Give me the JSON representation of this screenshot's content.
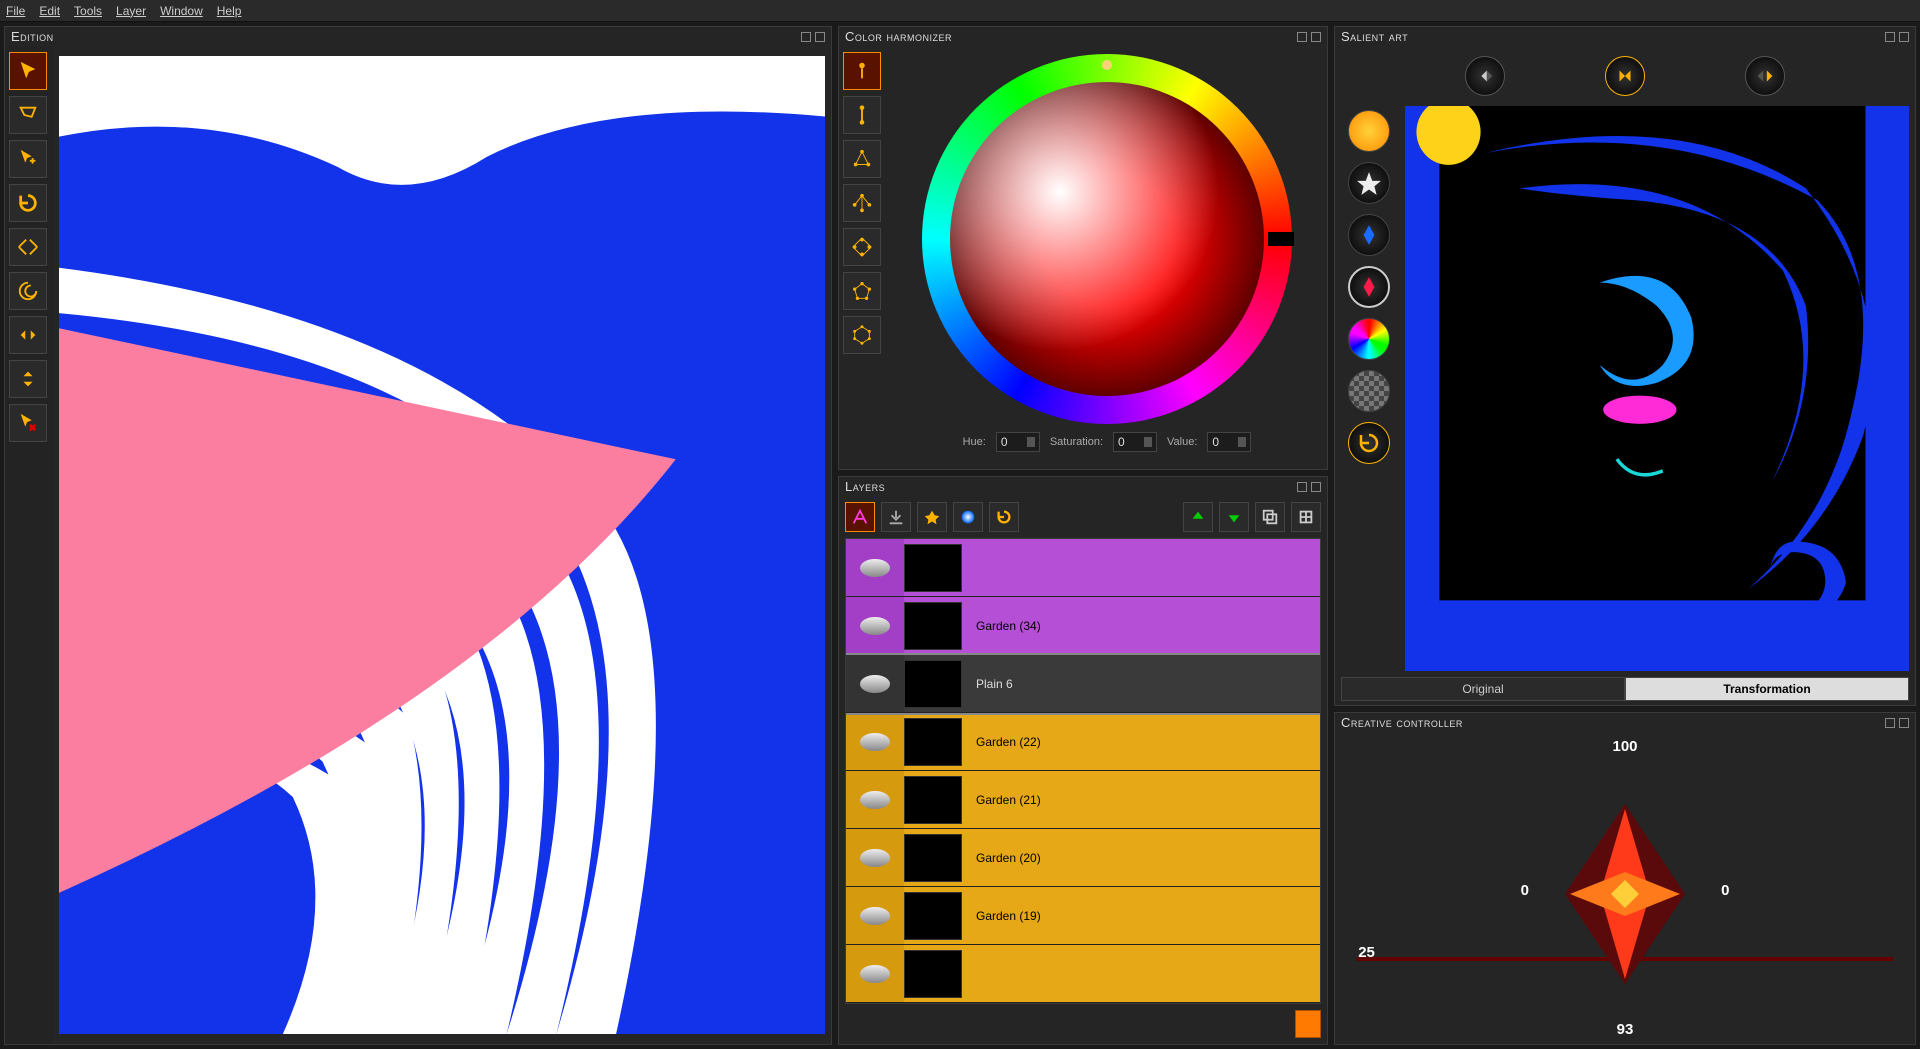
{
  "menu": {
    "file": "File",
    "edit": "Edit",
    "tools": "Tools",
    "layer": "Layer",
    "window": "Window",
    "help": "Help"
  },
  "panels": {
    "edition": "Edition",
    "harmonizer": "Color harmonizer",
    "layers": "Layers",
    "salient": "Salient art",
    "creative": "Creative controller"
  },
  "hsv": {
    "hue_label": "Hue:",
    "hue": "0",
    "sat_label": "Saturation:",
    "sat": "0",
    "val_label": "Value:",
    "val": "0"
  },
  "layers": [
    {
      "name": "",
      "style": "purple"
    },
    {
      "name": "Garden (34)",
      "style": "purple"
    },
    {
      "name": "Plain 6",
      "style": "dark",
      "selected": true
    },
    {
      "name": "Garden (22)",
      "style": "gold"
    },
    {
      "name": "Garden (21)",
      "style": "gold"
    },
    {
      "name": "Garden (20)",
      "style": "gold"
    },
    {
      "name": "Garden (19)",
      "style": "gold"
    },
    {
      "name": "",
      "style": "gold"
    }
  ],
  "salient": {
    "tab_original": "Original",
    "tab_transformation": "Transformation"
  },
  "creative": {
    "top": "100",
    "left": "0",
    "right": "0",
    "slider": "25",
    "bottom": "93"
  }
}
